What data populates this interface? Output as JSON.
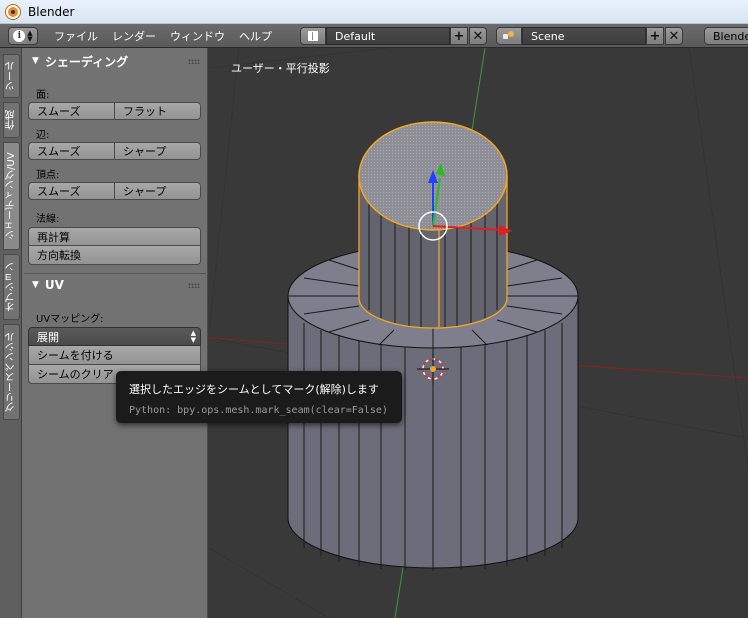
{
  "window": {
    "title": "Blender"
  },
  "menubar": {
    "menus": [
      "ファイル",
      "レンダー",
      "ウィンドウ",
      "ヘルプ"
    ],
    "layout": "Default",
    "scene": "Scene",
    "renderer": "Blender"
  },
  "tabs": [
    "ツール",
    "作成",
    "シェーディング/UV",
    "オプション",
    "グリースペンシル"
  ],
  "shading_panel": {
    "title": "シェーディング",
    "faces_label": "面:",
    "faces_buttons": [
      "スムーズ",
      "フラット"
    ],
    "edges_label": "辺:",
    "edges_buttons": [
      "スムーズ",
      "シャープ"
    ],
    "vertices_label": "頂点:",
    "vertices_buttons": [
      "スムーズ",
      "シャープ"
    ],
    "normals_label": "法線:",
    "recalculate": "再計算",
    "flip_direction": "方向転換"
  },
  "uv_panel": {
    "title": "UV",
    "mapping_label": "UVマッピング:",
    "unwrap": "展開",
    "mark_seam": "シームを付ける",
    "clear_seam": "シームのクリア"
  },
  "viewport": {
    "label": "ユーザー・平行投影"
  },
  "tooltip": {
    "text": "選択したエッジをシームとしてマーク(解除)します",
    "python": "Python: bpy.ops.mesh.mark_seam(clear=False)"
  },
  "colors": {
    "accent_orange": "#f5a623",
    "axis_x": "#e02020",
    "axis_y": "#20c020",
    "axis_z": "#2040ff"
  }
}
